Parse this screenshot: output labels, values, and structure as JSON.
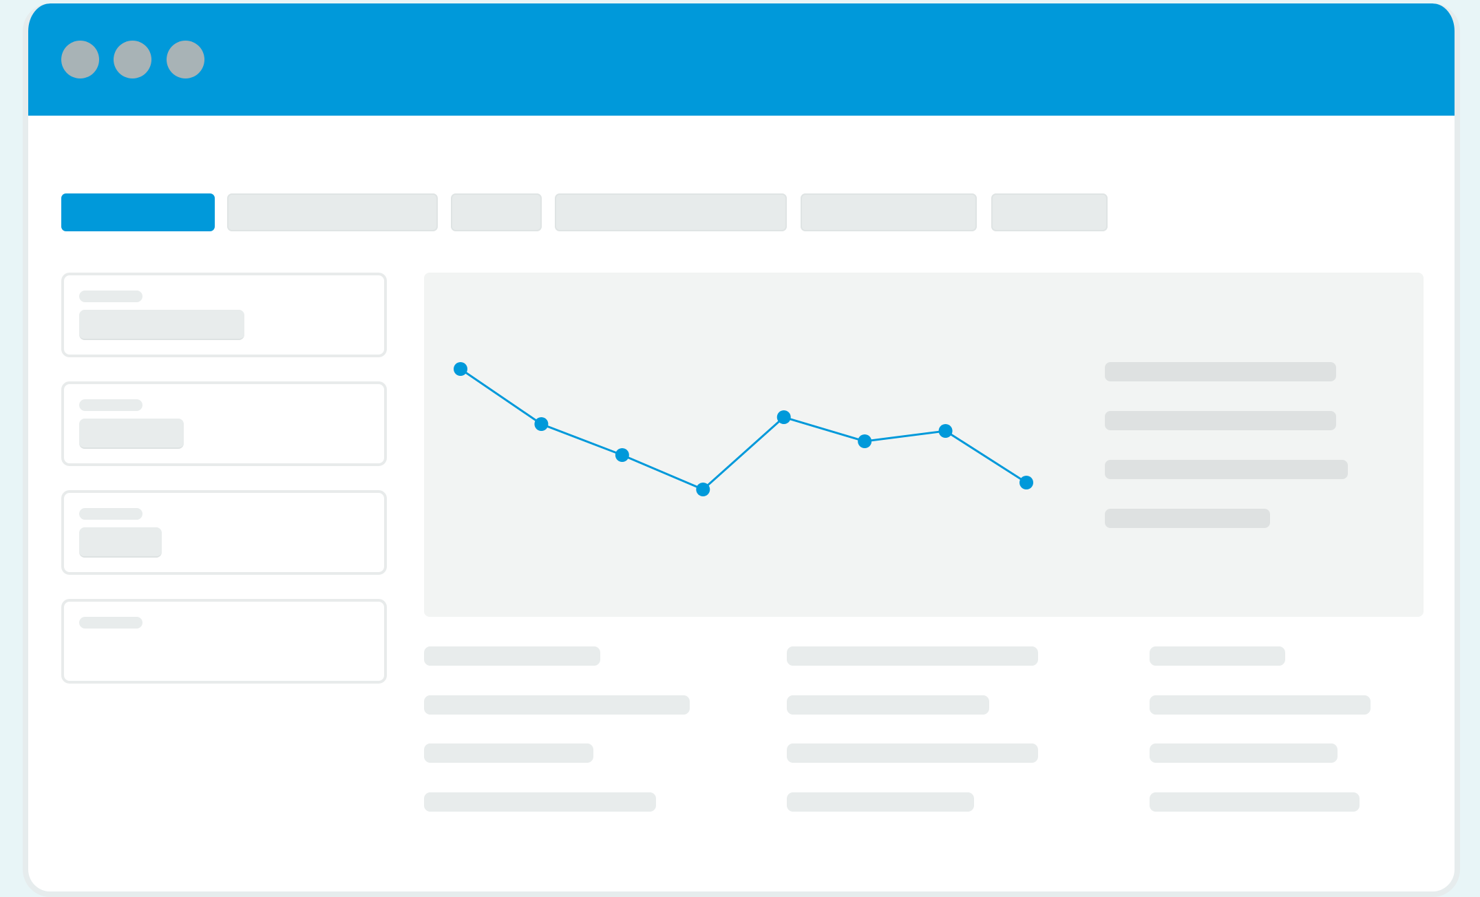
{
  "colors": {
    "accent": "#0099da",
    "titlebar": "#0099da",
    "window_dot": "#a8b3b6",
    "skeleton": "#e8ecec",
    "chart_background": "#f2f4f3"
  },
  "titlebar": {
    "controls": [
      "window-dot",
      "window-dot",
      "window-dot"
    ]
  },
  "tabs": [
    {
      "state": "active"
    },
    {
      "state": "inactive"
    },
    {
      "state": "inactive"
    },
    {
      "state": "inactive"
    },
    {
      "state": "inactive"
    },
    {
      "state": "inactive"
    }
  ],
  "chart_data": {
    "type": "line",
    "x": [
      1,
      2,
      3,
      4,
      5,
      6,
      7,
      8
    ],
    "series": [
      {
        "values": [
          7.2,
          5.6,
          4.7,
          3.7,
          5.8,
          5.1,
          5.4,
          3.9
        ]
      }
    ],
    "ylim": [
      0,
      10
    ],
    "grid": false,
    "legend": "right"
  }
}
